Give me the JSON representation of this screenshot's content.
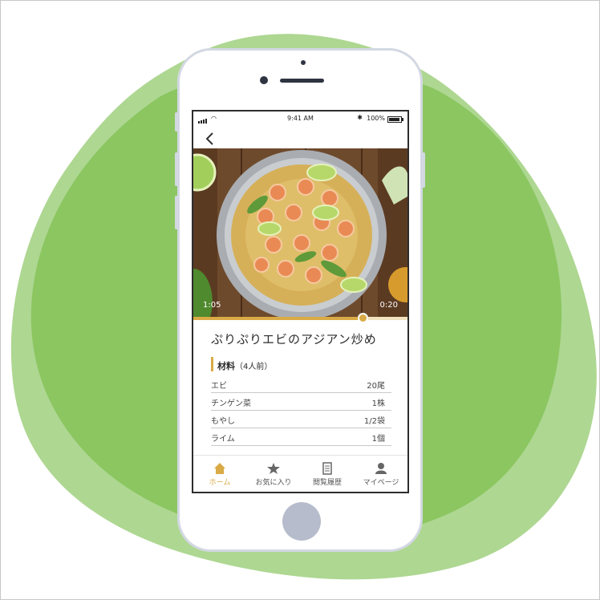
{
  "status_bar": {
    "time": "9:41 AM",
    "battery": "100%"
  },
  "video": {
    "current_time": "1:05",
    "duration": "0:20",
    "progress": 0.79
  },
  "recipe": {
    "title": "ぷりぷりエビのアジアン炒め",
    "ingredients_heading": "材料",
    "servings": "（4人前）",
    "ingredients": [
      {
        "name": "エビ",
        "qty": "20尾"
      },
      {
        "name": "チンゲン菜",
        "qty": "1株"
      },
      {
        "name": "もやし",
        "qty": "1/2袋"
      },
      {
        "name": "ライム",
        "qty": "1個"
      }
    ]
  },
  "tabs": [
    {
      "label": "ホーム",
      "icon": "home-icon",
      "active": true
    },
    {
      "label": "お気に入り",
      "icon": "star-icon",
      "active": false
    },
    {
      "label": "閲覧履歴",
      "icon": "history-icon",
      "active": false
    },
    {
      "label": "マイページ",
      "icon": "user-icon",
      "active": false
    }
  ],
  "colors": {
    "accent": "#d9aa45",
    "blob_dark": "#8bc660",
    "blob_light": "#aed792"
  }
}
